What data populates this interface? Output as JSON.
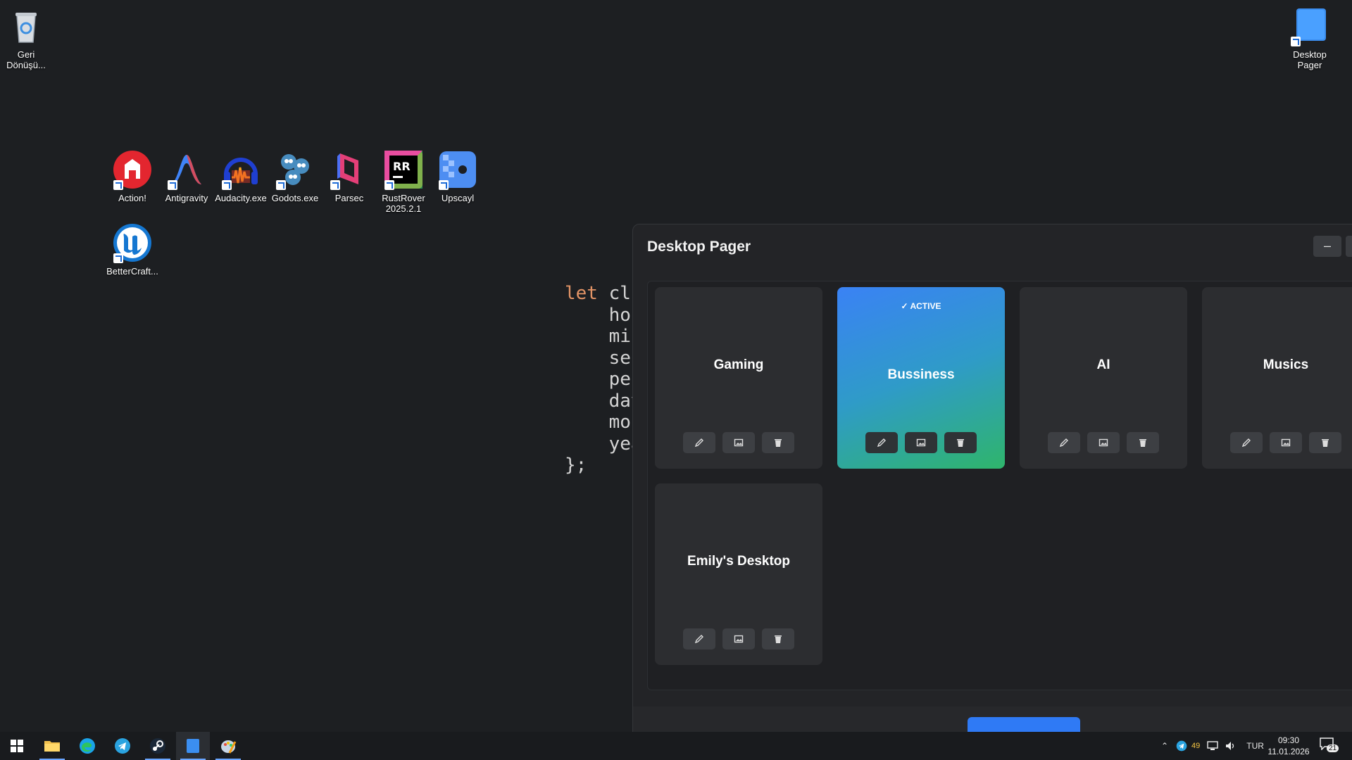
{
  "desktop": {
    "icons": [
      {
        "label": "Geri\nDönüşü...",
        "icon": "recycle-bin-icon"
      },
      {
        "label": "Desktop\nPager",
        "icon": "desktop-pager-icon"
      },
      {
        "label": "Action!",
        "icon": "action-icon"
      },
      {
        "label": "Antigravity",
        "icon": "antigravity-icon"
      },
      {
        "label": "Audacity.exe",
        "icon": "audacity-icon"
      },
      {
        "label": "Godots.exe",
        "icon": "godots-icon"
      },
      {
        "label": "Parsec",
        "icon": "parsec-icon"
      },
      {
        "label": "RustRover\n2025.2.1",
        "icon": "rustrover-icon"
      },
      {
        "label": "Upscayl",
        "icon": "upscayl-icon"
      },
      {
        "label": "BetterCraft...",
        "icon": "unreal-icon"
      }
    ],
    "code_lines": [
      "let cl",
      "    hou",
      "    mir",
      "    sec",
      "    per",
      "    day",
      "    mor",
      "    yea",
      "};"
    ]
  },
  "window": {
    "title": "Desktop Pager",
    "minimize_label": "–",
    "cards": [
      {
        "name": "Gaming",
        "active": false
      },
      {
        "name": "Bussiness",
        "active": true,
        "badge": "✓ ACTIVE"
      },
      {
        "name": "AI",
        "active": false
      },
      {
        "name": "Musics",
        "active": false
      },
      {
        "name": "Emily's Desktop",
        "active": false
      }
    ]
  },
  "taskbar": {
    "apps": [
      "windows-start-icon",
      "file-explorer-icon",
      "edge-icon",
      "telegram-icon",
      "steam-icon",
      "desktop-pager-icon",
      "paint-icon"
    ],
    "tray": {
      "notification_count": "49",
      "language": "TUR",
      "time": "09:30",
      "date": "11.01.2026",
      "action_center_count": "21"
    }
  },
  "colors": {
    "accent": "#2f7af5",
    "active_card_start": "#3a82f5",
    "active_card_end": "#2fb56b"
  }
}
